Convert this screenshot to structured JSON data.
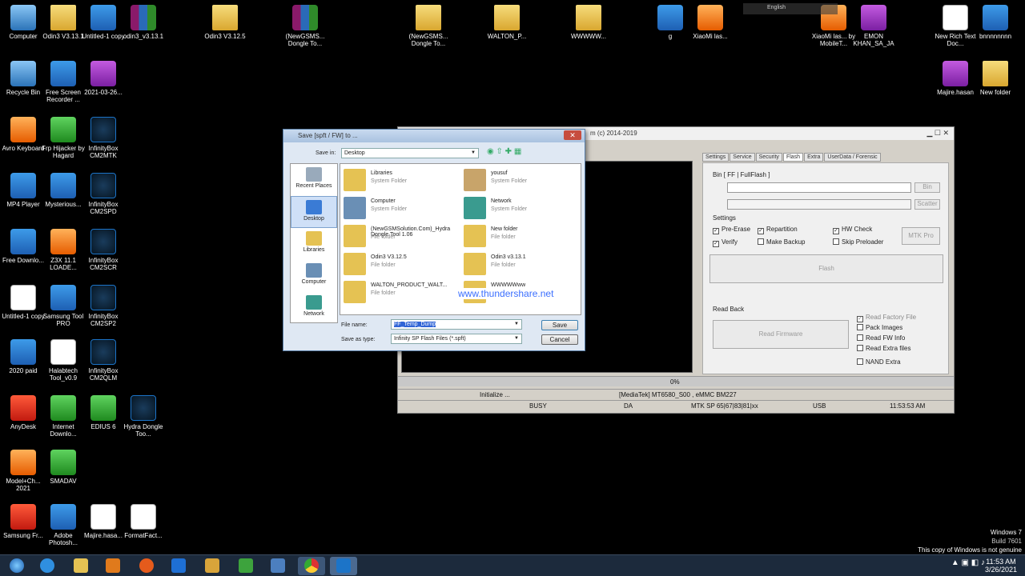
{
  "desktop_icons": [
    {
      "label": "Computer",
      "kind": "pc"
    },
    {
      "label": "Odin3 V3.13.1",
      "kind": "folder"
    },
    {
      "label": "Untitled-1 copy",
      "kind": "app"
    },
    {
      "label": "odin3_v3.13.1",
      "kind": "rar"
    },
    {
      "label": "Odin3 V3.12.5",
      "kind": "folder"
    },
    {
      "label": "(NewGSMS... Dongle To...",
      "kind": "rar"
    },
    {
      "label": "(NewGSMS... Dongle To...",
      "kind": "folder"
    },
    {
      "label": "WALTON_P...",
      "kind": "folder"
    },
    {
      "label": "WWWWW...",
      "kind": "folder"
    },
    {
      "label": "g",
      "kind": "app"
    },
    {
      "label": "XiaoMi las...",
      "kind": "org"
    },
    {
      "label": "XiaoMi las... by MobileT...",
      "kind": "org"
    },
    {
      "label": "EMON KHAN_SA_JA",
      "kind": "pur"
    },
    {
      "label": "New Rich Text Doc...",
      "kind": "doc"
    },
    {
      "label": "bnnnnnnnn",
      "kind": "app"
    },
    {
      "label": "Recycle Bin",
      "kind": "pc"
    },
    {
      "label": "Free Screen Recorder ...",
      "kind": "app"
    },
    {
      "label": "2021-03-26...",
      "kind": "pur"
    },
    {
      "label": "Majire.hasan",
      "kind": "pur"
    },
    {
      "label": "New folder",
      "kind": "folder"
    },
    {
      "label": "Avro Keyboard",
      "kind": "org"
    },
    {
      "label": "Frp Hijacker by Hagard",
      "kind": "grn"
    },
    {
      "label": "InfinityBox CM2MTK",
      "kind": "inf"
    },
    {
      "label": "MP4 Player",
      "kind": "app"
    },
    {
      "label": "Mysterious...",
      "kind": "app"
    },
    {
      "label": "InfinityBox CM2SPD",
      "kind": "inf"
    },
    {
      "label": "Free Downlo...",
      "kind": "app"
    },
    {
      "label": "Z3X 11.1 LOADE...",
      "kind": "org"
    },
    {
      "label": "InfinityBox CM2SCR",
      "kind": "inf"
    },
    {
      "label": "Untitled-1 copy",
      "kind": "doc"
    },
    {
      "label": "Samsung Tool PRO",
      "kind": "app"
    },
    {
      "label": "InfinityBox CM2SP2",
      "kind": "inf"
    },
    {
      "label": "2020 paid",
      "kind": "app"
    },
    {
      "label": "Halabtech Tool_v0.9",
      "kind": "doc"
    },
    {
      "label": "InfinityBox CM2QLM",
      "kind": "inf"
    },
    {
      "label": "AnyDesk",
      "kind": "red"
    },
    {
      "label": "Internet Downlo...",
      "kind": "grn"
    },
    {
      "label": "EDIUS 6",
      "kind": "grn"
    },
    {
      "label": "Hydra Dongle Too...",
      "kind": "inf"
    },
    {
      "label": "Model+Ch... 2021",
      "kind": "org"
    },
    {
      "label": "SMADAV",
      "kind": "grn"
    },
    {
      "label": "Samsung Fr...",
      "kind": "red"
    },
    {
      "label": "Adobe Photosh...",
      "kind": "app"
    },
    {
      "label": "Majire.hasa...",
      "kind": "doc"
    },
    {
      "label": "FormatFact...",
      "kind": "doc"
    }
  ],
  "tool": {
    "title": "m (c) 2014-2019",
    "tabs": [
      "Settings",
      "Service",
      "Security",
      "Flash",
      "Extra",
      "UserData / Forensic"
    ],
    "bin_group": "Bin [ FF | FullFlash ]",
    "bin_button": "Bin",
    "scatter_button": "Scatter",
    "settings_label": "Settings",
    "opt_pre_erase": "Pre-Erase",
    "opt_repartition": "Repartition",
    "opt_hw_check": "HW Check",
    "opt_verify": "Verify",
    "opt_make_backup": "Make Backup",
    "opt_skip_preloader": "Skip Preloader",
    "mtk_pro": "MTK Pro",
    "flash_button": "Flash",
    "readback_label": "Read Back",
    "read_firmware": "Read Firmware",
    "rf_factory": "Read Factory File",
    "rf_pack": "Pack Images",
    "rf_fwinfo": "Read FW Info",
    "rf_extra": "Read Extra files",
    "nand_extra": "NAND Extra",
    "progress_pct": "0%",
    "status_init": "Initialize ...",
    "status_device": "[MediaTek] MT6580_S00 , eMMC BM227",
    "st_busy": "BUSY",
    "st_da": "DA",
    "st_sp": "MTK SP 65|67|83|81|xx",
    "st_usb": "USB",
    "st_time": "11:53:53 AM"
  },
  "dialog": {
    "title": "Save [spft / FW] to ...",
    "save_in_label": "Save in:",
    "save_in_value": "Desktop",
    "places": [
      "Recent Places",
      "Desktop",
      "Libraries",
      "Computer",
      "Network"
    ],
    "files": [
      {
        "name": "Libraries",
        "type": "System Folder"
      },
      {
        "name": "yousuf",
        "type": "System Folder"
      },
      {
        "name": "Computer",
        "type": "System Folder"
      },
      {
        "name": "Network",
        "type": "System Folder"
      },
      {
        "name": "(NewGSMSolution.Com)_Hydra Dongle Tool 1.06",
        "type": "File folder"
      },
      {
        "name": "New folder",
        "type": "File folder"
      },
      {
        "name": "Odin3 V3.12.5",
        "type": "File folder"
      },
      {
        "name": "Odin3 v3.13.1",
        "type": "File folder"
      },
      {
        "name": "WALTON_PRODUCT_WALT...",
        "type": "File folder"
      },
      {
        "name": "WWWWWww",
        "type": "File folder"
      }
    ],
    "filename_label": "File name:",
    "filename_value": "FF_Temp_Dump",
    "savetype_label": "Save as type:",
    "savetype_value": "Infinity SP Flash Files (*.spft)",
    "save_button": "Save",
    "cancel_button": "Cancel"
  },
  "watermark": "www.thundershare.net",
  "taskbar": {
    "time": "11:53 AM",
    "date": "3/26/2021",
    "language": "English",
    "windows_line1": "Windows 7",
    "windows_line2": "Build 7601",
    "windows_line3": "This copy of Windows is not genuine"
  }
}
